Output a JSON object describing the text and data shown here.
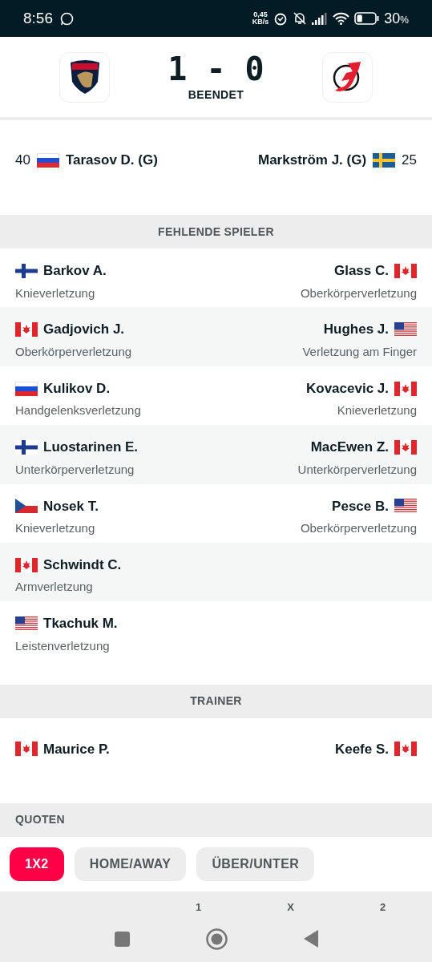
{
  "status_bar": {
    "time": "8:56",
    "net_speed_value": "0,45",
    "net_speed_unit": "KB/s",
    "battery": "30",
    "battery_unit": "%"
  },
  "match": {
    "score": "1 - 0",
    "status": "BEENDET"
  },
  "goalies": {
    "home": {
      "number": "40",
      "flag": {
        "kind": "ru"
      },
      "name": "Tarasov D. (G)"
    },
    "away": {
      "number": "25",
      "flag": {
        "kind": "se"
      },
      "name": "Markström J. (G)"
    }
  },
  "missing_players": {
    "title": "FEHLENDE SPIELER",
    "rows": [
      {
        "home": {
          "flag": {
            "kind": "fi"
          },
          "name": "Barkov A.",
          "reason": "Knieverletzung"
        },
        "away": {
          "flag": {
            "kind": "ca"
          },
          "name": "Glass C.",
          "reason": "Oberkörperverletzung"
        }
      },
      {
        "home": {
          "flag": {
            "kind": "ca"
          },
          "name": "Gadjovich J.",
          "reason": "Oberkörperverletzung"
        },
        "away": {
          "flag": {
            "kind": "us"
          },
          "name": "Hughes J.",
          "reason": "Verletzung am Finger"
        }
      },
      {
        "home": {
          "flag": {
            "kind": "ru"
          },
          "name": "Kulikov D.",
          "reason": "Handgelenksverletzung"
        },
        "away": {
          "flag": {
            "kind": "ca"
          },
          "name": "Kovacevic J.",
          "reason": "Knieverletzung"
        }
      },
      {
        "home": {
          "flag": {
            "kind": "fi"
          },
          "name": "Luostarinen E.",
          "reason": "Unterkörperverletzung"
        },
        "away": {
          "flag": {
            "kind": "ca"
          },
          "name": "MacEwen Z.",
          "reason": "Unterkörperverletzung"
        }
      },
      {
        "home": {
          "flag": {
            "kind": "cz"
          },
          "name": "Nosek T.",
          "reason": "Knieverletzung"
        },
        "away": {
          "flag": {
            "kind": "us"
          },
          "name": "Pesce B.",
          "reason": "Oberkörperverletzung"
        }
      },
      {
        "home": {
          "flag": {
            "kind": "ca"
          },
          "name": "Schwindt C.",
          "reason": "Armverletzung"
        }
      },
      {
        "home": {
          "flag": {
            "kind": "us"
          },
          "name": "Tkachuk M.",
          "reason": "Leistenverletzung"
        }
      }
    ]
  },
  "trainer": {
    "title": "TRAINER",
    "home": {
      "flag": {
        "kind": "ca"
      },
      "name": "Maurice P."
    },
    "away": {
      "flag": {
        "kind": "ca"
      },
      "name": "Keefe S."
    }
  },
  "odds": {
    "title": "QUOTEN",
    "tabs": [
      {
        "label": "1X2",
        "selected": true
      },
      {
        "label": "HOME/AWAY",
        "selected": false
      },
      {
        "label": "ÜBER/UNTER",
        "selected": false
      }
    ],
    "columns": [
      "1",
      "X",
      "2"
    ]
  }
}
